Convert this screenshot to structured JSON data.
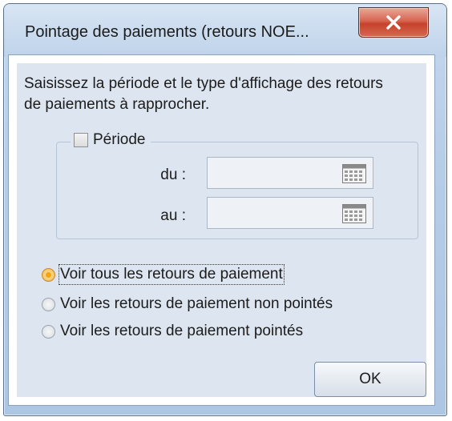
{
  "window": {
    "title": "Pointage des paiements (retours NOE...",
    "close_label": "x"
  },
  "intro_text": "Saisissez la période et le type d'affichage des retours de paiements à rapprocher.",
  "period": {
    "label": "Période",
    "checked": false,
    "from_label": "du :",
    "from_value": "",
    "to_label": "au :",
    "to_value": ""
  },
  "options": [
    {
      "label": "Voir tous les retours de paiement",
      "selected": true
    },
    {
      "label": "Voir les retours de paiement non pointés",
      "selected": false
    },
    {
      "label": "Voir les retours de paiement pointés",
      "selected": false
    }
  ],
  "ok_label": "OK",
  "colors": {
    "accent": "#f2a419",
    "panel_bg": "#dde5f0",
    "close_button": "#c6412b"
  }
}
